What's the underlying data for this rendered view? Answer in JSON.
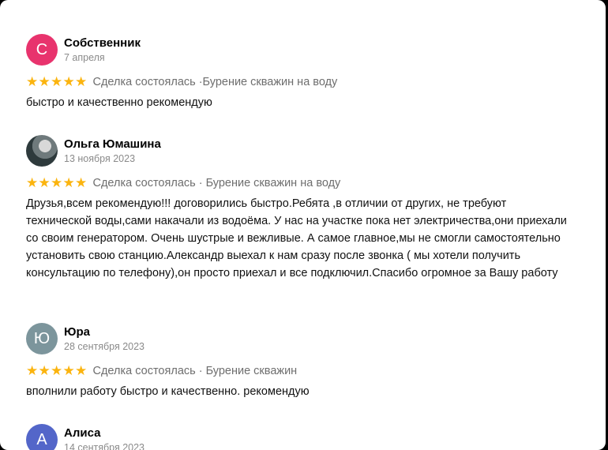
{
  "colors": {
    "star": "#fbb40f",
    "avatar_s": "#e8336d",
    "avatar_yu": "#7c959c",
    "avatar_a": "#5366c9"
  },
  "reviews": [
    {
      "initial": "С",
      "name": "Собственник",
      "date": "7 апреля",
      "rating": 5,
      "tag": "Сделка состоялась ·Бурение скважин на воду",
      "text": "быстро и качественно рекомендую"
    },
    {
      "initial": "",
      "avatar_icon": "user-photo-icon",
      "name": "Ольга Юмашина",
      "date": "13 ноября 2023",
      "rating": 5,
      "tag": "Сделка состоялась · Бурение скважин на воду",
      "text": "Друзья,всем рекомендую!!! договорились быстро.Ребята ,в отличии от других, не требуют технической воды,сами накачали из водоёма. У нас на участке пока нет электричества,они приехали со своим генератором. Очень шустрые и вежливые. А самое главное,мы не смогли самостоятельно установить свою станцию.Александр выехал к нам сразу после звонка ( мы хотели получить консультацию по телефону),он просто приехал и все подключил.Спасибо огромное за Вашу работу"
    },
    {
      "initial": "Ю",
      "name": "Юра",
      "date": "28 сентября 2023",
      "rating": 5,
      "tag": "Сделка состоялась · Бурение скважин",
      "text": "вполнили работу быстро и качественно. рекомендую"
    },
    {
      "initial": "А",
      "name": "Алиса",
      "date": "14 сентября 2023"
    }
  ]
}
